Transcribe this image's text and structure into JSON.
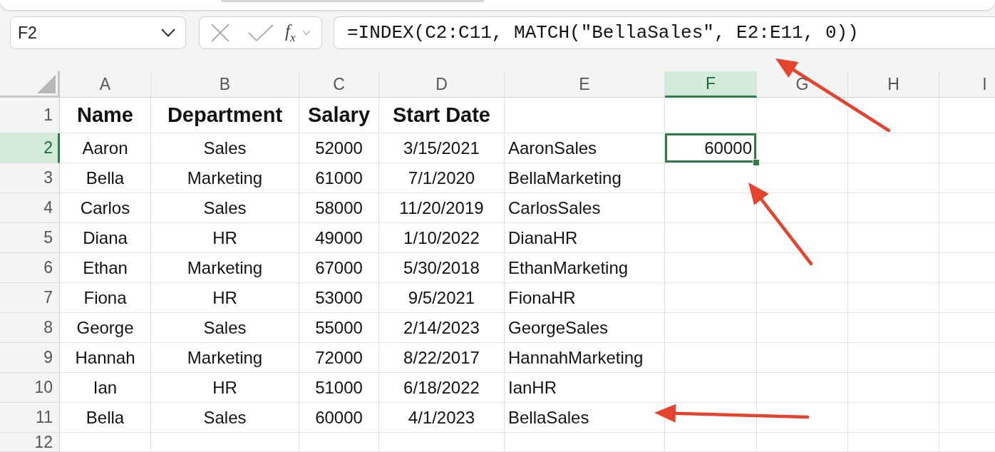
{
  "formula_bar": {
    "name_box": "F2",
    "edit_buttons_disabled": true,
    "function_label": "f$_{x}$",
    "formula": "=INDEX(C2:C11, MATCH(\"BellaSales\", E2:E11, 0))"
  },
  "columns": [
    {
      "label": "A",
      "selected": false
    },
    {
      "label": "B",
      "selected": false
    },
    {
      "label": "C",
      "selected": false
    },
    {
      "label": "D",
      "selected": false
    },
    {
      "label": "E",
      "selected": false
    },
    {
      "label": "F",
      "selected": true
    },
    {
      "label": "G",
      "selected": false
    },
    {
      "label": "H",
      "selected": false
    },
    {
      "label": "I",
      "selected": false
    }
  ],
  "rows": [
    {
      "kind": "header",
      "number": "1",
      "selected": false,
      "cells": [
        "Name",
        "Department",
        "Salary",
        "Start Date"
      ]
    },
    {
      "kind": "data",
      "number": "2",
      "selected": true,
      "cells": [
        "Aaron",
        "Sales",
        "52000",
        "3/15/2021",
        "AaronSales",
        "60000"
      ]
    },
    {
      "kind": "data",
      "number": "3",
      "selected": false,
      "cells": [
        "Bella",
        "Marketing",
        "61000",
        "7/1/2020",
        "BellaMarketing"
      ]
    },
    {
      "kind": "data",
      "number": "4",
      "selected": false,
      "cells": [
        "Carlos",
        "Sales",
        "58000",
        "11/20/2019",
        "CarlosSales"
      ]
    },
    {
      "kind": "data",
      "number": "5",
      "selected": false,
      "cells": [
        "Diana",
        "HR",
        "49000",
        "1/10/2022",
        "DianaHR"
      ]
    },
    {
      "kind": "data",
      "number": "6",
      "selected": false,
      "cells": [
        "Ethan",
        "Marketing",
        "67000",
        "5/30/2018",
        "EthanMarketing"
      ]
    },
    {
      "kind": "data",
      "number": "7",
      "selected": false,
      "cells": [
        "Fiona",
        "HR",
        "53000",
        "9/5/2021",
        "FionaHR"
      ]
    },
    {
      "kind": "data",
      "number": "8",
      "selected": false,
      "cells": [
        "George",
        "Sales",
        "55000",
        "2/14/2023",
        "GeorgeSales"
      ]
    },
    {
      "kind": "data",
      "number": "9",
      "selected": false,
      "cells": [
        "Hannah",
        "Marketing",
        "72000",
        "8/22/2017",
        "HannahMarketing"
      ]
    },
    {
      "kind": "data",
      "number": "10",
      "selected": false,
      "cells": [
        "Ian",
        "HR",
        "51000",
        "6/18/2022",
        "IanHR"
      ]
    },
    {
      "kind": "data",
      "number": "11",
      "selected": false,
      "cells": [
        "Bella",
        "Sales",
        "60000",
        "4/1/2023",
        "BellaSales"
      ]
    },
    {
      "kind": "data",
      "number": "12",
      "selected": false
    }
  ]
}
